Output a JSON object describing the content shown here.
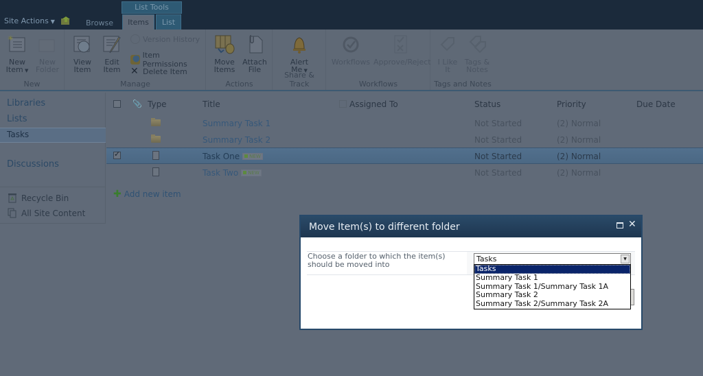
{
  "topbar": {
    "site_actions": "Site Actions",
    "browse_tab": "Browse",
    "contextual_group": "List Tools",
    "items_tab": "Items",
    "list_tab": "List"
  },
  "ribbon": {
    "groups": {
      "new": "New",
      "manage": "Manage",
      "actions": "Actions",
      "share_track": "Share & Track",
      "workflows": "Workflows",
      "tags_notes": "Tags and Notes"
    },
    "buttons": {
      "new_item_1": "New",
      "new_item_2": "Item",
      "new_folder_1": "New",
      "new_folder_2": "Folder",
      "view_item_1": "View",
      "view_item_2": "Item",
      "edit_item_1": "Edit",
      "edit_item_2": "Item",
      "version_history": "Version History",
      "item_permissions": "Item Permissions",
      "delete_item": "Delete Item",
      "move_items_1": "Move",
      "move_items_2": "Items",
      "attach_file_1": "Attach",
      "attach_file_2": "File",
      "alert_me_1": "Alert",
      "alert_me_2": "Me",
      "workflows": "Workflows",
      "approve_reject": "Approve/Reject",
      "i_like_it_1": "I Like",
      "i_like_it_2": "It",
      "tags_notes_1": "Tags &",
      "tags_notes_2": "Notes"
    }
  },
  "leftnav": {
    "libraries": "Libraries",
    "lists": "Lists",
    "tasks": "Tasks",
    "discussions": "Discussions",
    "recycle_bin": "Recycle Bin",
    "all_site_content": "All Site Content"
  },
  "list": {
    "columns": {
      "type": "Type",
      "title": "Title",
      "assigned_to": "Assigned To",
      "status": "Status",
      "priority": "Priority",
      "due_date": "Due Date"
    },
    "rows": [
      {
        "type": "folder",
        "title": "Summary Task 1",
        "status": "Not Started",
        "priority": "(2) Normal",
        "checked": false,
        "new": false
      },
      {
        "type": "folder",
        "title": "Summary Task 2",
        "status": "Not Started",
        "priority": "(2) Normal",
        "checked": false,
        "new": false
      },
      {
        "type": "document",
        "title": "Task One",
        "status": "Not Started",
        "priority": "(2) Normal",
        "checked": true,
        "new": true
      },
      {
        "type": "document",
        "title": "Task Two",
        "status": "Not Started",
        "priority": "(2) Normal",
        "checked": false,
        "new": true
      }
    ],
    "new_badge": "NEW",
    "add_new_item": "Add new item"
  },
  "dialog": {
    "title": "Move Item(s) to different folder",
    "label": "Choose a folder to which the item(s) should be moved into",
    "selected_value": "Tasks",
    "options": [
      "Tasks",
      "Summary Task 1",
      "Summary Task 1/Summary Task 1A",
      "Summary Task 2",
      "Summary Task 2/Summary Task 2A"
    ],
    "highlighted_option_index": 0
  }
}
